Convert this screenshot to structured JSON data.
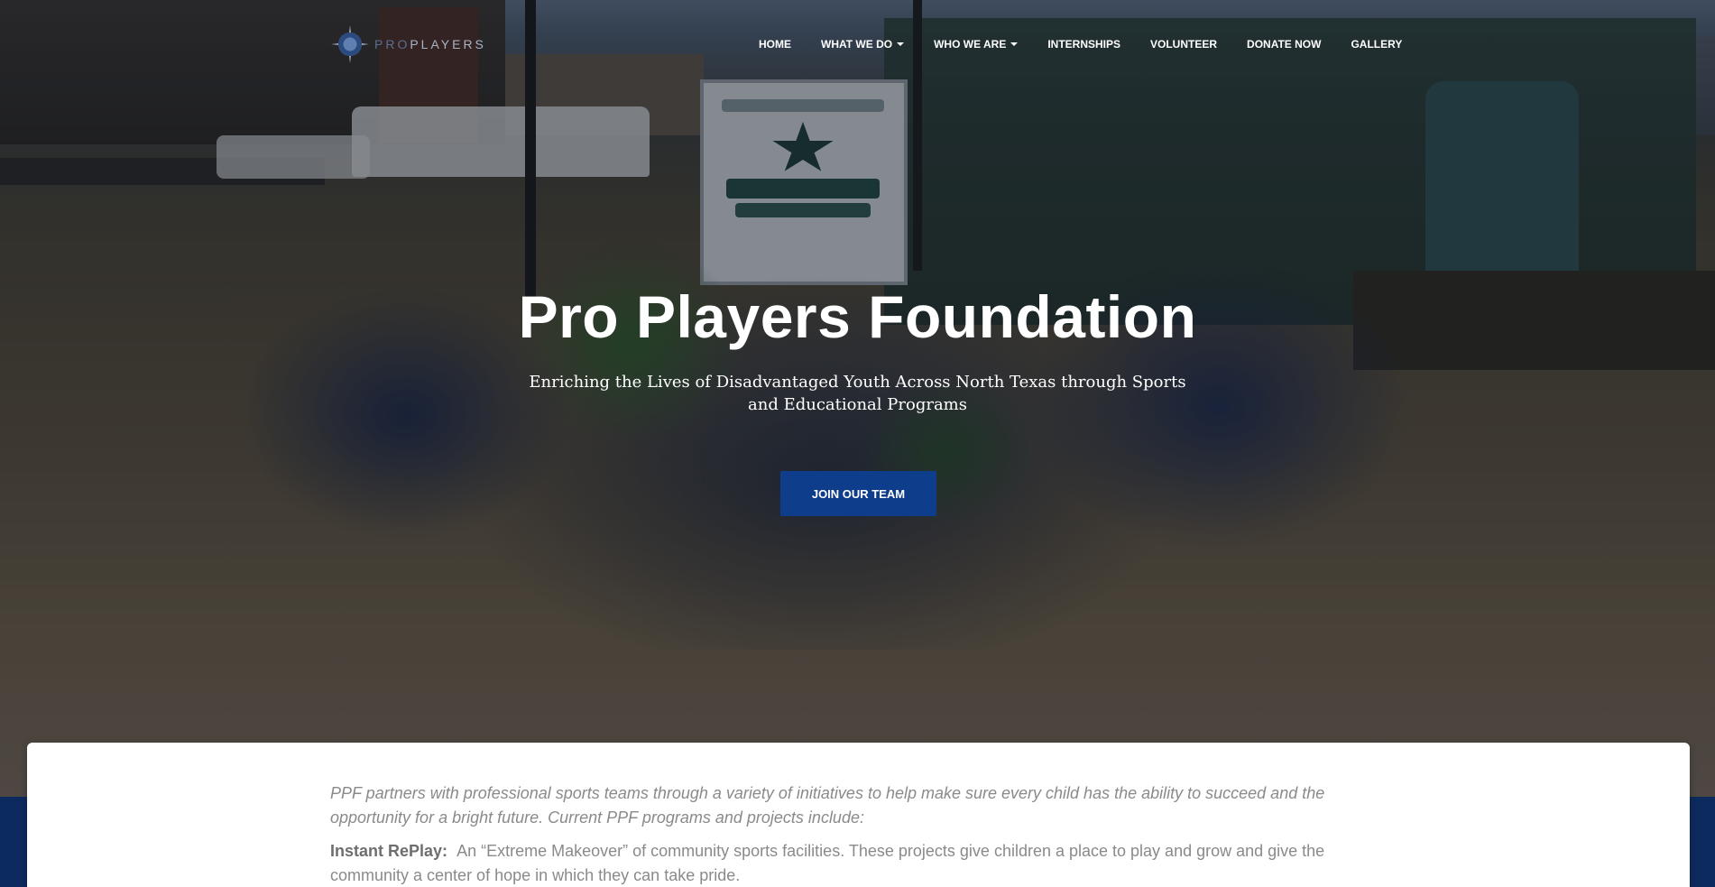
{
  "brand": {
    "name": "PRO PLAYERS",
    "name_prefix": "PRO",
    "name_rest": "PLAYERS"
  },
  "nav": {
    "items": [
      {
        "label": "HOME",
        "dropdown": false
      },
      {
        "label": "WHAT WE DO",
        "dropdown": true
      },
      {
        "label": "WHO WE ARE",
        "dropdown": true
      },
      {
        "label": "INTERNSHIPS",
        "dropdown": false
      },
      {
        "label": "VOLUNTEER",
        "dropdown": false
      },
      {
        "label": "DONATE NOW",
        "dropdown": false
      },
      {
        "label": "GALLERY",
        "dropdown": false
      }
    ]
  },
  "hero": {
    "title": "Pro Players Foundation",
    "subtitle": "Enriching the Lives of Disadvantaged Youth Across North Texas through Sports and Educational Programs",
    "cta_label": "JOIN OUR TEAM"
  },
  "content": {
    "intro": "PPF partners with professional sports teams through a variety of initiatives to help make sure every child has the ability to succeed and the opportunity for a bright future. Current PPF programs and projects include:",
    "program_name": "Instant RePlay:",
    "program_text": "An “Extreme Makeover” of community sports facilities. These projects give children a place to play and grow and give the community a center of hope in which they can take pride."
  },
  "colors": {
    "accent": "#0e3d8c",
    "band": "#0d2a5e"
  }
}
